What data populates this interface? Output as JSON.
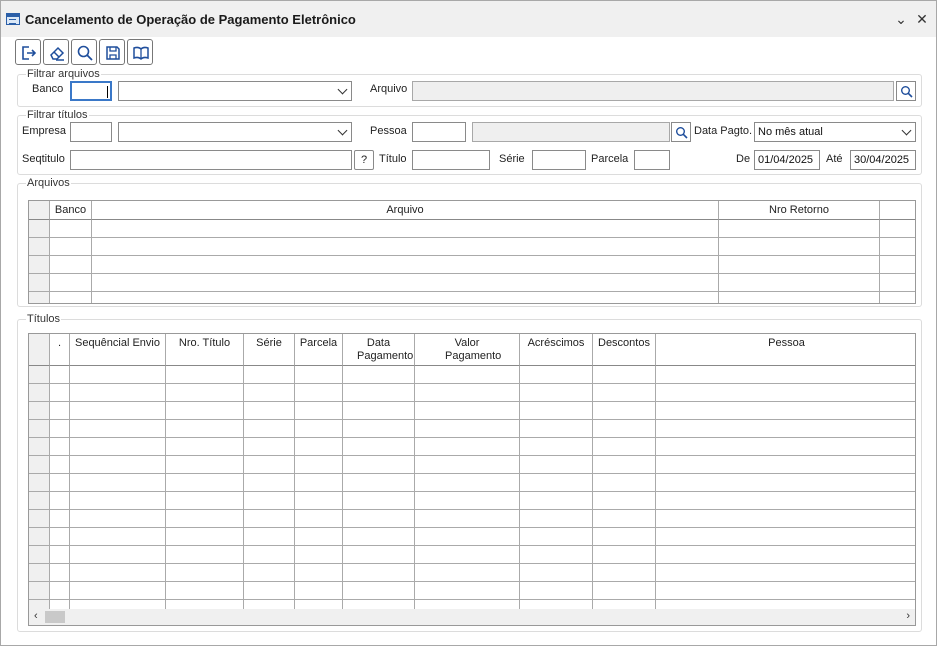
{
  "window": {
    "title": "Cancelamento de Operação de Pagamento Eletrônico",
    "minimize_glyph": "⌄",
    "close_glyph": "✕"
  },
  "toolbar": {
    "buttons": [
      {
        "name": "exit-icon"
      },
      {
        "name": "eraser-icon"
      },
      {
        "name": "search-icon"
      },
      {
        "name": "save-icon"
      },
      {
        "name": "book-icon"
      }
    ]
  },
  "filtrar_arquivos": {
    "legend": "Filtrar arquivos",
    "banco_label": "Banco",
    "banco_value": "",
    "banco_nome_value": "",
    "arquivo_label": "Arquivo",
    "arquivo_value": ""
  },
  "filtrar_titulos": {
    "legend": "Filtrar títulos",
    "empresa_label": "Empresa",
    "empresa_value": "",
    "empresa_nome_value": "",
    "pessoa_label": "Pessoa",
    "pessoa_value": "",
    "pessoa_nome_value": "",
    "data_pagto_label": "Data Pagto.",
    "data_pagto_value": "No mês atual",
    "seqtitulo_label": "Seqtitulo",
    "seqtitulo_value": "",
    "help_label": "?",
    "titulo_label": "Título",
    "titulo_value": "",
    "serie_label": "Série",
    "serie_value": "",
    "parcela_label": "Parcela",
    "parcela_value": "",
    "de_label": "De",
    "de_value": "01/04/2025",
    "ate_label": "Até",
    "ate_value": "30/04/2025"
  },
  "arquivos": {
    "legend": "Arquivos",
    "columns": [
      "Banco",
      "Arquivo",
      "Nro Retorno"
    ],
    "row_count": 5
  },
  "titulos": {
    "legend": "Títulos",
    "columns": [
      ".",
      "Sequêncial Envio",
      "Nro. Título",
      "Série",
      "Parcela",
      "Data Pagamento",
      "Valor Pagamento",
      "Acréscimos",
      "Descontos",
      "Pessoa"
    ],
    "row_count": 14,
    "scroll_left": "‹",
    "scroll_right": "›"
  }
}
